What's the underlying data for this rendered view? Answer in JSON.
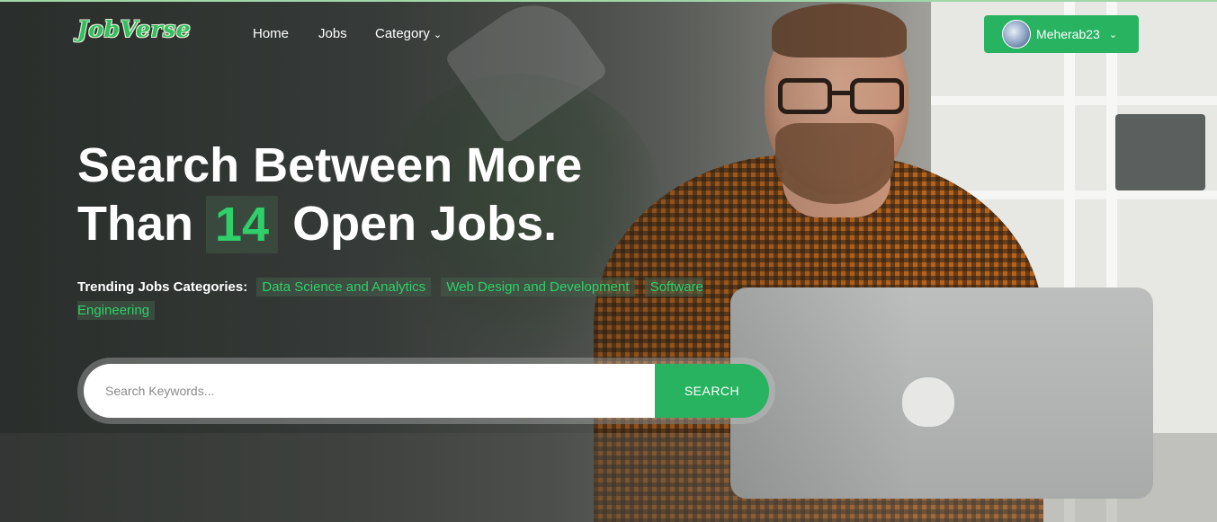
{
  "brand": {
    "logo_text": "JobVerse",
    "accent_color": "#27b360"
  },
  "nav": {
    "items": [
      {
        "label": "Home"
      },
      {
        "label": "Jobs"
      },
      {
        "label": "Category"
      }
    ]
  },
  "user": {
    "name": "Meherab23"
  },
  "hero": {
    "title_line1": "Search Between More",
    "title_prefix": "Than",
    "job_count": "14",
    "title_suffix": "Open Jobs.",
    "trending_label": "Trending Jobs Categories:",
    "trending_tags": [
      "Data Science and Analytics",
      "Web Design and Development",
      "Software Engineering"
    ]
  },
  "search": {
    "placeholder": "Search Keywords...",
    "value": "",
    "button_label": "SEARCH"
  }
}
